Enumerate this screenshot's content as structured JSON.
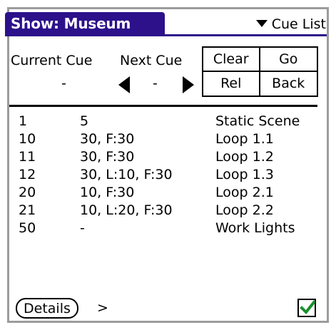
{
  "colors": {
    "accent": "#2c118b",
    "check": "#18902c"
  },
  "header": {
    "title": "Show: Museum",
    "menu_label": "Cue List",
    "menu_icon": "triangle-down-icon"
  },
  "status": {
    "current_label": "Current Cue",
    "current_value": "-",
    "next_label": "Next Cue",
    "next_value": "-"
  },
  "buttons": {
    "clear": "Clear",
    "go": "Go",
    "rel": "Rel",
    "back": "Back"
  },
  "cues": [
    {
      "number": "1",
      "timing": "5",
      "name": "Static Scene"
    },
    {
      "number": "10",
      "timing": "30, F:30",
      "name": "Loop 1.1"
    },
    {
      "number": "11",
      "timing": "30, F:30",
      "name": "Loop 1.2"
    },
    {
      "number": "12",
      "timing": "30, L:10, F:30",
      "name": "Loop 1.3"
    },
    {
      "number": "20",
      "timing": "10, F:30",
      "name": "Loop 2.1"
    },
    {
      "number": "21",
      "timing": "10, L:20, F:30",
      "name": "Loop 2.2"
    },
    {
      "number": "50",
      "timing": "-",
      "name": "Work Lights"
    }
  ],
  "footer": {
    "details_label": "Details",
    "more_indicator": ">",
    "checkbox_checked": true
  }
}
